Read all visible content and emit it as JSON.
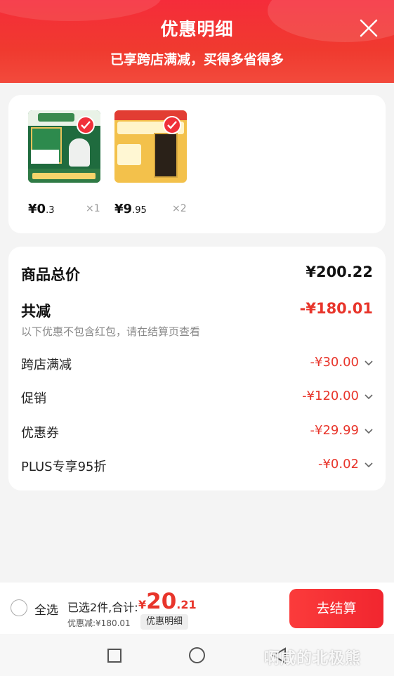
{
  "header": {
    "title": "优惠明细",
    "subtitle": "已享跨店满减，买得多省得多",
    "close_icon": "close-icon"
  },
  "products": [
    {
      "price_int": "¥0",
      "price_dec": ".3",
      "qty": "×1",
      "checked": true,
      "image_text": [
        "国药堂",
        "品种齐全",
        "中药抓配",
        "GMP",
        "中药饮片",
        "深圳药店 品质放心"
      ]
    },
    {
      "price_int": "¥9",
      "price_dec": ".95",
      "qty": "×2",
      "checked": true,
      "image_text": [
        "京东买药",
        "4重花样",
        "39"
      ]
    }
  ],
  "summary": {
    "total_label": "商品总价",
    "total_value": "¥200.22",
    "reduce_label": "共减",
    "reduce_value": "-¥180.01",
    "note": "以下优惠不包含红包，请在结算页查看",
    "items": [
      {
        "label": "跨店满减",
        "value": "-¥30.00"
      },
      {
        "label": "促销",
        "value": "-¥120.00"
      },
      {
        "label": "优惠券",
        "value": "-¥29.99"
      },
      {
        "label": "PLUS专享95折",
        "value": "-¥0.02"
      }
    ]
  },
  "bottom": {
    "select_all": "全选",
    "selected_text": "已选2件,合计:",
    "total_symbol": "¥",
    "total_int": "20",
    "total_dec": ".21",
    "discount_text": "优惠减:¥180.01",
    "detail_chip": "优惠明细",
    "checkout": "去结算"
  },
  "system_nav": {
    "watermark": "啊咸的北极熊"
  },
  "colors": {
    "accent": "#e8352b",
    "header_red": "#f52c3a",
    "checkout_red": "#f1262f"
  }
}
